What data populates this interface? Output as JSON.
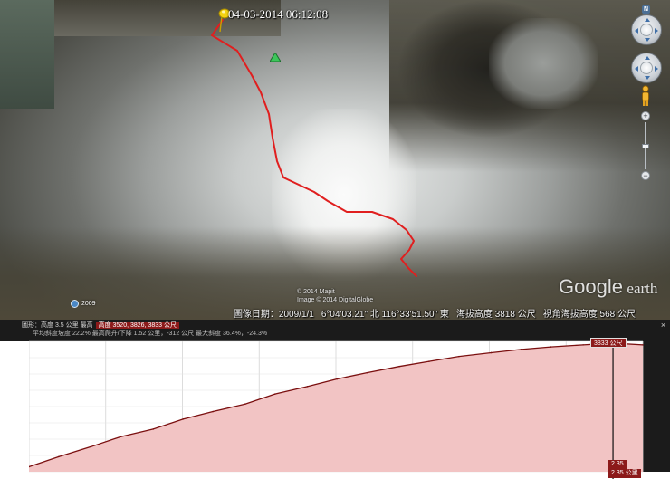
{
  "map": {
    "track_timestamp": "04-03-2014 06:12:08",
    "imagery_credit_lines": [
      "© 2014 Mapit",
      "Image © 2014 DigitalGlobe"
    ],
    "imagery_year": "2009",
    "logo_word_google": "Google",
    "logo_word_earth": "earth",
    "status": {
      "imagery_date": "圖像日期：2009/1/1",
      "coordinates": "6°04'03.21\" 北 116°33'51.50\" 東",
      "elevation": "海拔高度 3818 公尺",
      "eye_altitude": "視角海拔高度 568 公尺"
    },
    "track_color": "#e01f1f",
    "flag_icon": "yellow-pushpin",
    "peak_icon": "green-triangle"
  },
  "navigation": {
    "north_label": "N",
    "zoom_in_label": "+",
    "zoom_out_label": "−"
  },
  "profile": {
    "header_line1_text": "圖形：高度 3.5 公里 最高",
    "header_line1_highlight": "高度 3520, 3826, 3833 公尺",
    "header_line2_text": "平均斜度坡度 22.2% 最高爬升/下降 1.52 公里，-312 公尺 最大斜度 36.4%，-24.3%",
    "current_value_label": "3833 公尺",
    "cursor_label_top": "2.35",
    "cursor_label_bottom": "2.35 公里",
    "close_label": "×"
  },
  "chart_data": {
    "type": "area",
    "x": [
      0,
      0.12,
      0.25,
      0.37,
      0.5,
      0.62,
      0.74,
      0.87,
      0.99,
      1.12,
      1.24,
      1.36,
      1.49,
      1.61,
      1.73,
      1.86,
      1.98,
      2.1,
      2.23,
      2.35,
      2.47
    ],
    "y": [
      3340,
      3380,
      3420,
      3460,
      3490,
      3530,
      3560,
      3590,
      3630,
      3660,
      3690,
      3715,
      3740,
      3760,
      3780,
      3795,
      3808,
      3818,
      3826,
      3833,
      3826
    ],
    "ylim": [
      3320,
      3840
    ],
    "fill_color": "#f2c4c4",
    "line_color": "#7a0f0f",
    "cursor_x": 2.35,
    "grid": true
  }
}
